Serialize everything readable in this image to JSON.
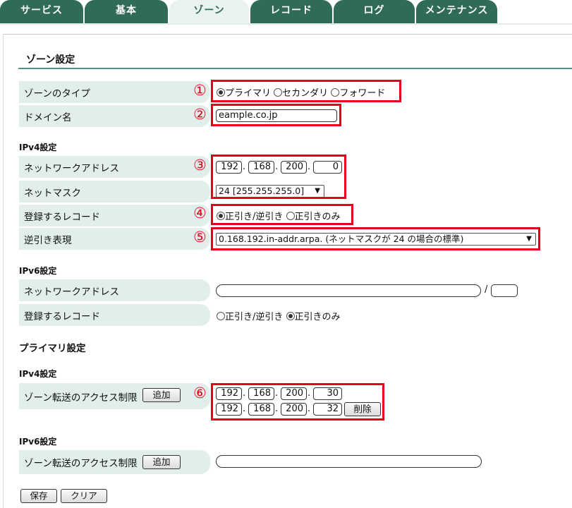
{
  "tabs": [
    {
      "label": "サービス",
      "active": false
    },
    {
      "label": "基本",
      "active": false
    },
    {
      "label": "ゾーン",
      "active": true
    },
    {
      "label": "レコード",
      "active": false
    },
    {
      "label": "ログ",
      "active": false
    },
    {
      "label": "メンテナンス",
      "active": false
    }
  ],
  "zone_settings": {
    "title": "ゾーン設定",
    "zone_type": {
      "label": "ゾーンのタイプ",
      "options": [
        "プライマリ",
        "セカンダリ",
        "フォワード"
      ],
      "selected": "プライマリ"
    },
    "domain": {
      "label": "ドメイン名",
      "value": "eample.co.jp"
    },
    "ipv4": {
      "heading": "IPv4設定",
      "network_address": {
        "label": "ネットワークアドレス",
        "octets": [
          "192",
          "168",
          "200",
          "0"
        ]
      },
      "netmask": {
        "label": "ネットマスク",
        "value": "24 [255.255.255.0]"
      },
      "records": {
        "label": "登録するレコード",
        "options": [
          "正引き/逆引き",
          "正引きのみ"
        ],
        "selected": "正引き/逆引き"
      },
      "reverse": {
        "label": "逆引き表現",
        "value": "0.168.192.in-addr.arpa. (ネットマスクが 24 の場合の標準)"
      }
    },
    "ipv6": {
      "heading": "IPv6設定",
      "network_address": {
        "label": "ネットワークアドレス",
        "value": "",
        "prefix": "",
        "separator": "/"
      },
      "records": {
        "label": "登録するレコード",
        "options": [
          "正引き/逆引き",
          "正引きのみ"
        ],
        "selected": "正引きのみ"
      }
    }
  },
  "primary_settings": {
    "title": "プライマリ設定",
    "ipv4": {
      "heading": "IPv4設定",
      "access_label": "ゾーン転送のアクセス制限",
      "add_button": "追加",
      "rows": [
        {
          "octets": [
            "192",
            "168",
            "200",
            "30"
          ]
        },
        {
          "octets": [
            "192",
            "168",
            "200",
            "32"
          ]
        }
      ],
      "delete_button": "削除"
    },
    "ipv6": {
      "heading": "IPv6設定",
      "access_label": "ゾーン転送のアクセス制限",
      "add_button": "追加",
      "value": ""
    }
  },
  "actions": {
    "save": "保存",
    "clear": "クリア"
  },
  "annotations": [
    "①",
    "②",
    "③",
    "④",
    "⑤",
    "⑥"
  ],
  "colors": {
    "tab_bg": "#2f6b56",
    "tab_active_bg": "#eaf2ef",
    "label_bg": "#e2eeec",
    "highlight": "#e2001a"
  }
}
